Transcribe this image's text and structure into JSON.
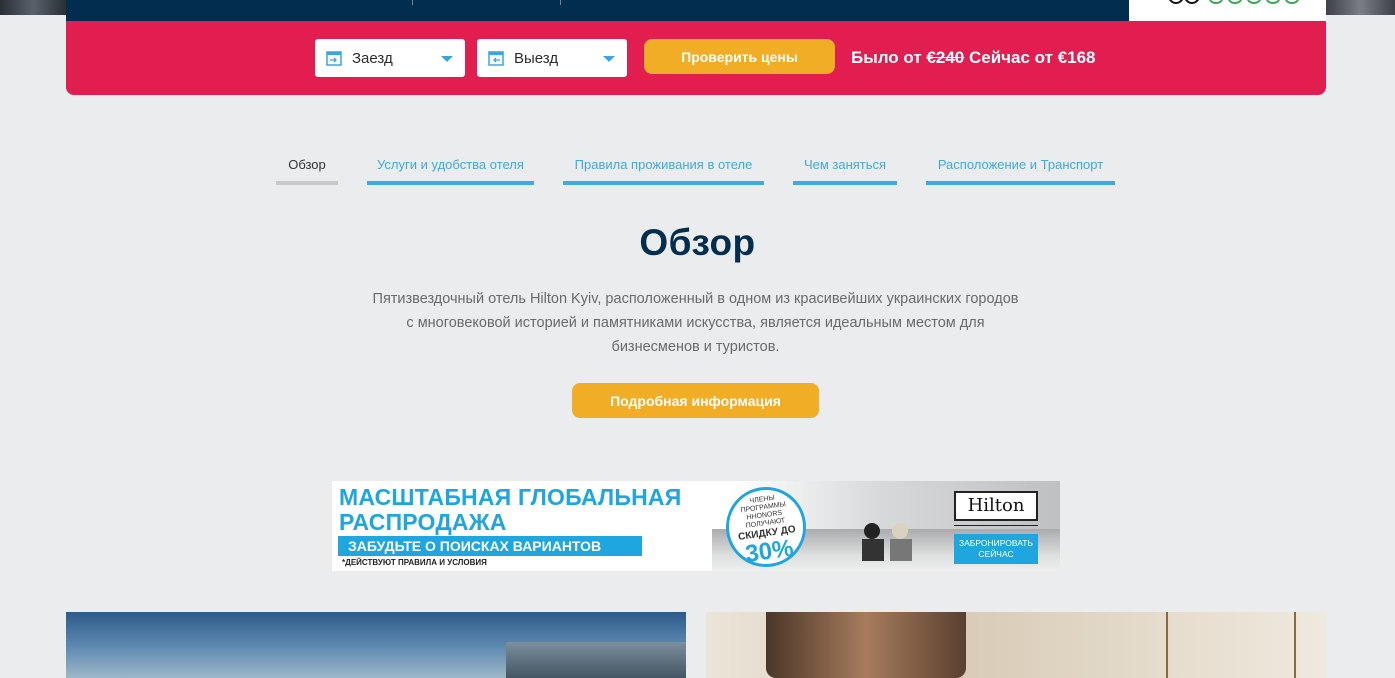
{
  "booking": {
    "checkin_label": "Заезд",
    "checkout_label": "Выезд",
    "check_prices_button": "Проверить цены",
    "price_prefix": "Было от ",
    "old_price": "€240",
    "price_middle": " Сейчас от ",
    "new_price": "€168"
  },
  "tabs": [
    {
      "label": "Обзор",
      "active": true
    },
    {
      "label": "Услуги и удобства отеля",
      "active": false
    },
    {
      "label": "Правила проживания в отеле",
      "active": false
    },
    {
      "label": "Чем заняться",
      "active": false
    },
    {
      "label": "Расположение и Транспорт",
      "active": false
    }
  ],
  "overview": {
    "title": "Обзор",
    "description": "Пятизвездочный отель Hilton Kyiv, расположенный в одном из красивейших украинских городов с многовековой историей и памятниками искусства, является идеальным местом для бизнесменов и туристов.",
    "more_button": "Подробная информация"
  },
  "banner": {
    "headline_line1": "МАСШТАБНАЯ ГЛОБАЛЬНАЯ",
    "headline_line2": "РАСПРОДАЖА",
    "strip": "ЗАБУДЬТЕ О ПОИСКАХ ВАРИАНТОВ",
    "terms": "*ДЕЙСТВУЮТ ПРАВИЛА И УСЛОВИЯ",
    "badge_small": "ЧЛЕНЫ ПРОГРАММЫ HHONORS ПОЛУЧАЮТ",
    "badge_mid": "СКИДКУ ДО",
    "badge_big": "30%",
    "brand": "Hilton",
    "book_line1": "ЗАБРОНИРОВАТЬ",
    "book_line2": "СЕЙЧАС"
  },
  "colors": {
    "booking_bar": "#e21d50",
    "accent_button": "#f2ad26",
    "navy": "#032d4e",
    "link_blue": "#41a9e1"
  }
}
